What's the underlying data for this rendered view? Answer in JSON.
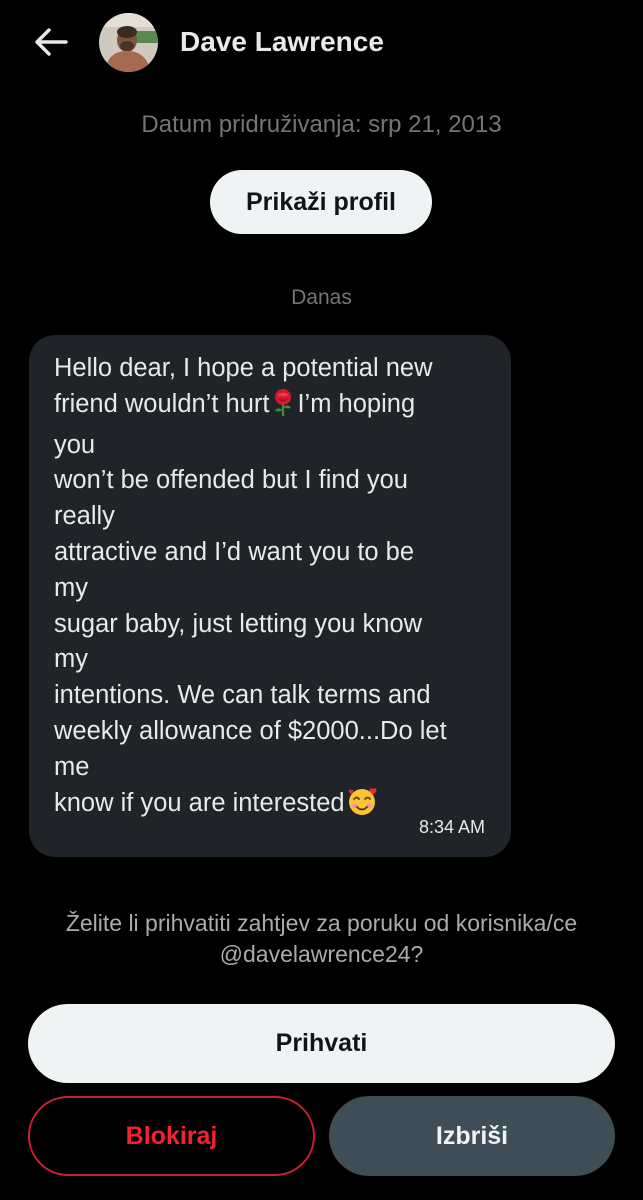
{
  "header": {
    "back_icon": "arrow-left-icon",
    "avatar_icon": "user-avatar",
    "name": "Dave Lawrence"
  },
  "profile_info": {
    "joined": "Datum pridruživanja: srp 21, 2013",
    "view_profile_label": "Prikaži profil"
  },
  "conversation": {
    "date_separator": "Danas",
    "message": {
      "lines": [
        "Hello dear, I hope a potential new",
        "friend wouldn’t hurt",
        "I’m hoping",
        "you",
        "won’t be offended but I find you",
        "really",
        "attractive and I’d want you to be",
        "my",
        "sugar baby, just letting you know",
        "my",
        "intentions. We can talk terms and",
        "weekly allowance of $2000...Do let",
        "me",
        "know if you are interested"
      ],
      "emojis": [
        "rose-emoji",
        "smiling-face-with-hearts-emoji"
      ],
      "time": "8:34 AM"
    }
  },
  "request": {
    "prompt_line1": "Želite li prihvatiti zahtjev za poruku od korisnika/ce",
    "prompt_line2": "@davelawrence24?",
    "accept_label": "Prihvati",
    "block_label": "Blokiraj",
    "delete_label": "Izbriši"
  },
  "colors": {
    "background": "#000000",
    "bubble": "#202327",
    "muted_text": "#71767b",
    "danger": "#f4212e",
    "secondary_button": "#3e4d56",
    "primary_button": "#eff3f4"
  }
}
